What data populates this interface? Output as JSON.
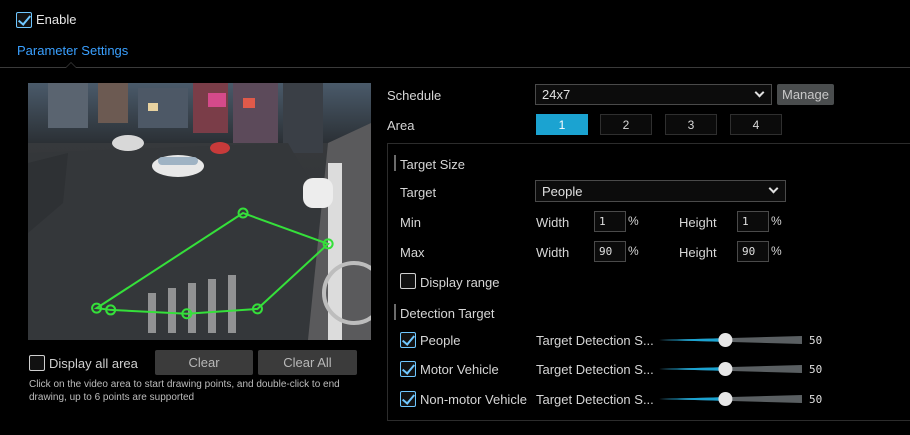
{
  "enable": {
    "label": "Enable",
    "checked": true
  },
  "tabs": [
    {
      "label": "Parameter Settings",
      "active": true
    }
  ],
  "video": {
    "polygon_points": [
      [
        0.627,
        0.506
      ],
      [
        0.875,
        0.626
      ],
      [
        0.669,
        0.879
      ],
      [
        0.463,
        0.898
      ],
      [
        0.241,
        0.883
      ],
      [
        0.2,
        0.876
      ]
    ]
  },
  "display_all_area": {
    "label": "Display all area",
    "checked": false
  },
  "buttons": {
    "clear": "Clear",
    "clear_all": "Clear All",
    "manage": "Manage"
  },
  "hint": "Click on the video area to start drawing points, and double-click to end drawing, up to 6 points are supported",
  "schedule": {
    "label": "Schedule",
    "value": "24x7"
  },
  "area": {
    "label": "Area",
    "options": [
      "1",
      "2",
      "3",
      "4"
    ],
    "selected": "1"
  },
  "target_size": {
    "title": "Target Size",
    "target_label": "Target",
    "target_value": "People",
    "min_label": "Min",
    "max_label": "Max",
    "width_label": "Width",
    "height_label": "Height",
    "min_width": "1",
    "min_height": "1",
    "max_width": "90",
    "max_height": "90",
    "unit": "%",
    "display_range": {
      "label": "Display range",
      "checked": false
    }
  },
  "detection_target": {
    "title": "Detection Target",
    "items": [
      {
        "label": "People",
        "checked": true,
        "sensitivity_label": "Target Detection S...",
        "value": "50",
        "level": 0.5
      },
      {
        "label": "Motor Vehicle",
        "checked": true,
        "sensitivity_label": "Target Detection S...",
        "value": "50",
        "level": 0.5
      },
      {
        "label": "Non-motor Vehicle",
        "checked": true,
        "sensitivity_label": "Target Detection S...",
        "value": "50",
        "level": 0.5
      }
    ]
  },
  "colors": {
    "accent": "#3aa0ff",
    "active_area": "#1ba3d1",
    "slider_fill": "#1ba3d1",
    "polygon": "#35e03a"
  }
}
